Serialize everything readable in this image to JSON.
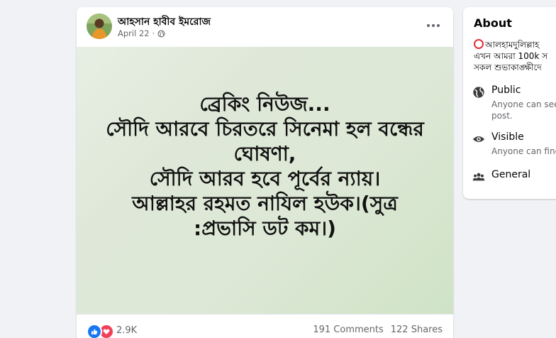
{
  "post": {
    "author": "আহসান হাবীব ইমরোজ",
    "date": "April 22",
    "separator": "·",
    "image_text": "ব্রেকিং নিউজ...\nসৌদি আরবে চিরতরে সিনেমা হল বন্ধের ঘোষণা,\nসৌদি আরব হবে পূর্বের ন্যায়।\nআল্লাহর রহমত নাযিল হউক।(সুত্র :প্রভাসি ডট কম।)",
    "reactions_count": "2.9K",
    "comments": "191 Comments",
    "shares": "122 Shares",
    "icons": {
      "more": "more-options-icon",
      "privacy": "globe-icon",
      "like": "like-reaction-icon",
      "love": "love-reaction-icon"
    }
  },
  "about": {
    "title": "About",
    "description_lines": [
      "আলহামদুলিল্লাহ",
      "এখন আমরা 100k স",
      "সকল শুভাকাঙ্ক্ষীদে"
    ],
    "public": {
      "title": "Public",
      "line1": "Anyone can see",
      "line2": "post."
    },
    "visible": {
      "title": "Visible",
      "line1": "Anyone can find"
    },
    "general": {
      "title": "General"
    }
  },
  "colors": {
    "background": "#f0f2f5",
    "card": "#ffffff",
    "secondary_text": "#65676b",
    "like_blue": "#1877f2",
    "love_red": "#f33e58"
  }
}
